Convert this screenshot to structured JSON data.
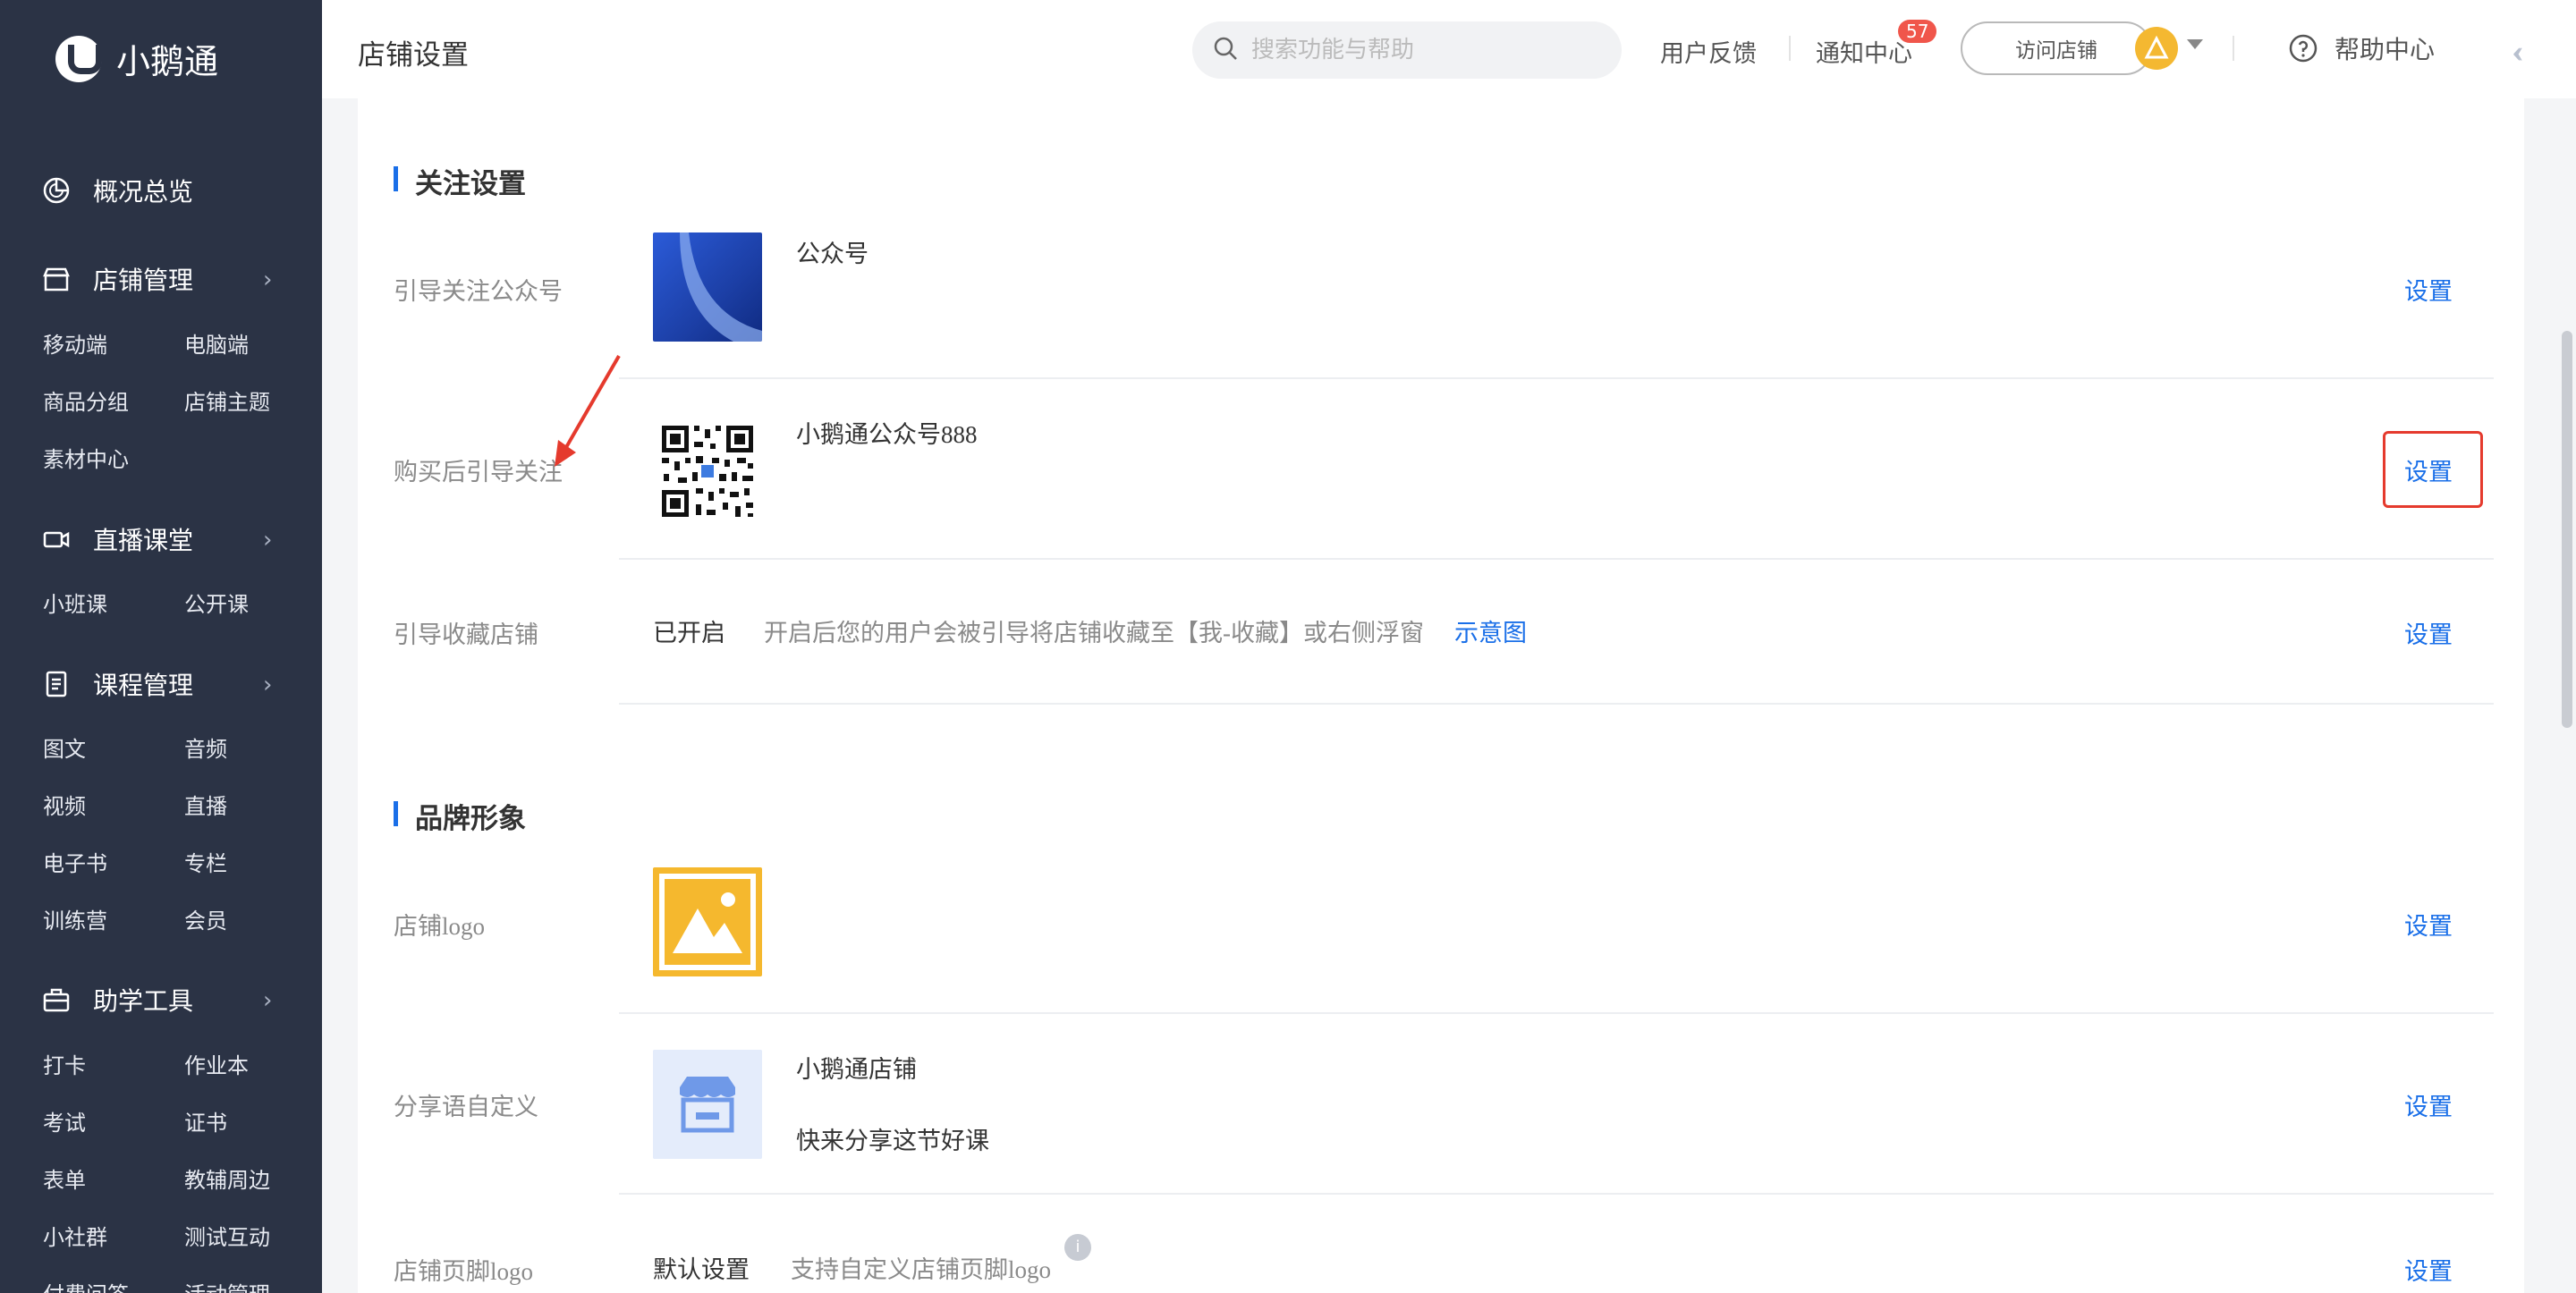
{
  "brand": {
    "name": "小鹅通"
  },
  "sidebar": {
    "overview": "概况总览",
    "groups": [
      {
        "title": "店铺管理",
        "icon": "store-icon",
        "items": [
          "移动端",
          "电脑端",
          "商品分组",
          "店铺主题",
          "素材中心"
        ]
      },
      {
        "title": "直播课堂",
        "icon": "video-camera-icon",
        "items": [
          "小班课",
          "公开课"
        ]
      },
      {
        "title": "课程管理",
        "icon": "document-icon",
        "items": [
          "图文",
          "音频",
          "视频",
          "直播",
          "电子书",
          "专栏",
          "训练营",
          "会员"
        ]
      },
      {
        "title": "助学工具",
        "icon": "toolbox-icon",
        "items": [
          "打卡",
          "作业本",
          "考试",
          "证书",
          "表单",
          "教辅周边",
          "小社群",
          "测试互动",
          "付费问答",
          "活动管理"
        ]
      }
    ]
  },
  "header": {
    "title": "店铺设置",
    "search_placeholder": "搜索功能与帮助",
    "feedback": "用户反馈",
    "notifications": "通知中心",
    "notification_count": "57",
    "visit_store": "访问店铺",
    "help_center": "帮助中心"
  },
  "sections": {
    "follow": {
      "title": "关注设置",
      "rows": {
        "guide_follow": {
          "label": "引导关注公众号",
          "value": "公众号",
          "action": "设置"
        },
        "after_purchase": {
          "label": "购买后引导关注",
          "value": "小鹅通公众号888",
          "action": "设置"
        },
        "guide_favorite": {
          "label": "引导收藏店铺",
          "status": "已开启",
          "desc": "开启后您的用户会被引导将店铺收藏至【我-收藏】或右侧浮窗",
          "link": "示意图",
          "action": "设置"
        }
      }
    },
    "brand": {
      "title": "品牌形象",
      "rows": {
        "logo": {
          "label": "店铺logo",
          "action": "设置"
        },
        "share": {
          "label": "分享语自定义",
          "title": "小鹅通店铺",
          "subtitle": "快来分享这节好课",
          "action": "设置"
        },
        "footer_logo": {
          "label": "店铺页脚logo",
          "status": "默认设置",
          "desc": "支持自定义店铺页脚logo",
          "info": "i",
          "action": "设置"
        }
      }
    }
  },
  "colors": {
    "sidebar_bg": "#2b3345",
    "accent": "#1a6fe8",
    "highlight": "#e53a2d",
    "badge": "#f0564b"
  }
}
